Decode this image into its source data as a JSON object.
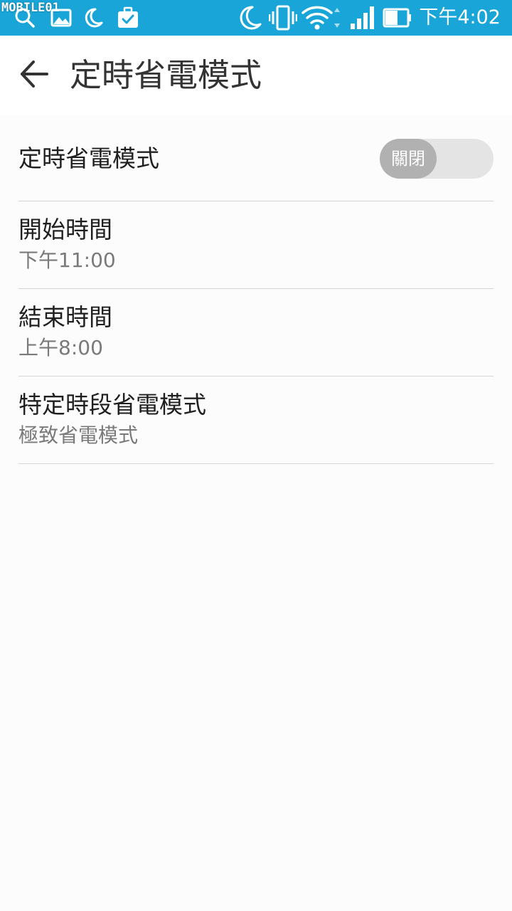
{
  "status_bar": {
    "watermark": "MOBILE01",
    "time": "下午4:02",
    "colors": {
      "background": "#19a5d7",
      "icon": "#ffffff"
    },
    "left_icons": [
      "search-icon",
      "image-icon",
      "moon-icon",
      "briefcase-check-icon"
    ],
    "right_icons": [
      "moon-icon",
      "vibrate-icon",
      "wifi-icon",
      "signal-icon",
      "battery-icon"
    ]
  },
  "app_bar": {
    "back_icon": "arrow-left-icon",
    "title": "定時省電模式"
  },
  "settings": {
    "schedule_toggle": {
      "label": "定時省電模式",
      "state_label": "關閉",
      "enabled": false
    },
    "start_time": {
      "label": "開始時間",
      "value": "下午11:00"
    },
    "end_time": {
      "label": "結束時間",
      "value": "上午8:00"
    },
    "mode": {
      "label": "特定時段省電模式",
      "value": "極致省電模式"
    }
  },
  "colors": {
    "page_background": "#fcfcfc",
    "divider": "#d6d6d6",
    "toggle_track": "#e4e4e4",
    "toggle_knob": "#b1b1b1"
  }
}
